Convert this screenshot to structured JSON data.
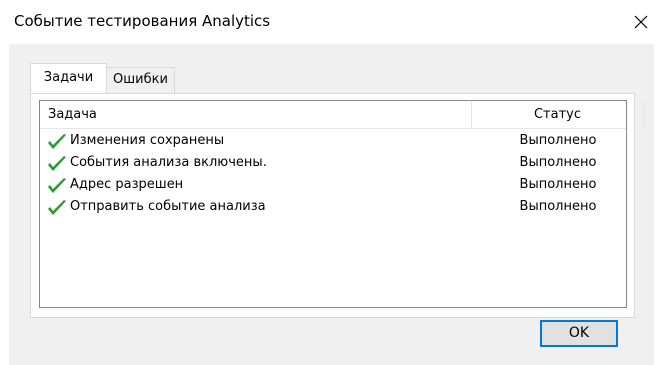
{
  "window": {
    "title": "Событие тестирования Analytics",
    "close_icon": "close-icon"
  },
  "tabs": [
    {
      "label": "Задачи",
      "active": true
    },
    {
      "label": "Ошибки",
      "active": false
    }
  ],
  "table": {
    "columns": [
      "Задача",
      "Статус"
    ],
    "rows": [
      {
        "icon": "checkmark-icon",
        "task": "Изменения сохранены",
        "status": "Выполнено"
      },
      {
        "icon": "checkmark-icon",
        "task": "События анализа включены.",
        "status": "Выполнено"
      },
      {
        "icon": "checkmark-icon",
        "task": "Адрес разрешен",
        "status": "Выполнено"
      },
      {
        "icon": "checkmark-icon",
        "task": "Отправить событие анализа",
        "status": "Выполнено"
      }
    ]
  },
  "buttons": {
    "ok": "OK"
  },
  "colors": {
    "accent": "#0078d7",
    "check": "#2e9a2e",
    "panel_bg": "#f0f0f0"
  }
}
